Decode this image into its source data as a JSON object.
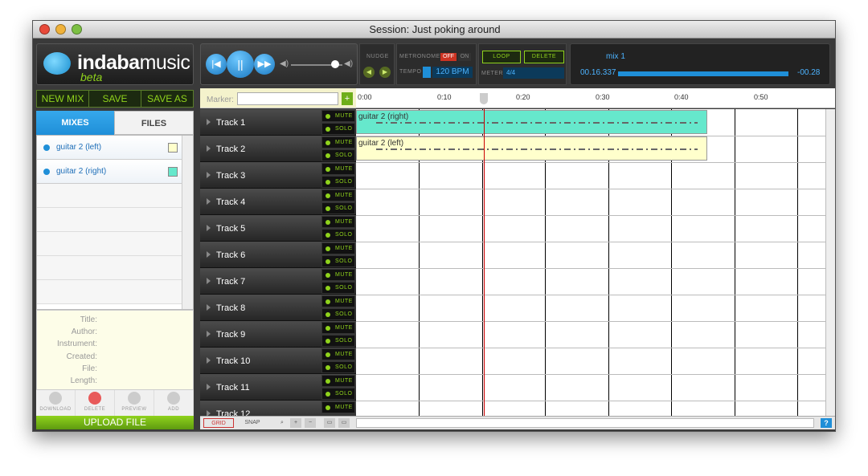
{
  "window": {
    "title": "Session: Just poking around"
  },
  "brand": {
    "name_bold": "indaba",
    "name_light": "music",
    "sub": "beta"
  },
  "file_buttons": {
    "new_mix": "NEW MIX",
    "save": "SAVE",
    "save_as": "SAVE AS"
  },
  "tabs": {
    "mixes": "MIXES",
    "files": "FILES"
  },
  "mixes": [
    {
      "label": "guitar 2 (left)",
      "color": "#ffffcc"
    },
    {
      "label": "guitar 2 (right)",
      "color": "#66e8cc"
    }
  ],
  "info_labels": {
    "title": "Title:",
    "author": "Author:",
    "instrument": "Instrument:",
    "created": "Created:",
    "file": "File:",
    "length": "Length:"
  },
  "info_buttons": {
    "download": "DOWNLOAD",
    "delete": "DELETE",
    "preview": "PREVIEW",
    "add": "ADD"
  },
  "upload": "UPLOAD FILE",
  "controls": {
    "nudge": "NUDGE",
    "metronome": "METRONOME",
    "off": "OFF",
    "on": "ON",
    "tempo": "TEMPO",
    "bpm": "120 BPM",
    "meter": "METER",
    "meter_value": "4/4",
    "loop": "LOOP",
    "delete": "DELETE"
  },
  "mix_display": {
    "name": "mix 1",
    "elapsed": "00.16.337",
    "remaining": "-00.28"
  },
  "progress": 0.85,
  "marker_label": "Marker:",
  "ruler": [
    "0:00",
    "0:10",
    "0:20",
    "0:30",
    "0:40",
    "0:50"
  ],
  "tracks": [
    "Track 1",
    "Track 2",
    "Track 3",
    "Track 4",
    "Track 5",
    "Track 6",
    "Track 7",
    "Track 8",
    "Track 9",
    "Track 10",
    "Track 11",
    "Track 12"
  ],
  "track_buttons": {
    "mute": "MUTE",
    "solo": "SOLO"
  },
  "clips": [
    {
      "label": "guitar 2 (right)",
      "color": "#66e8cc"
    },
    {
      "label": "guitar 2 (left)",
      "color": "#ffffcc"
    }
  ],
  "bottombar": {
    "grid": "GRID",
    "snap": "SNAP",
    "help": "?"
  }
}
